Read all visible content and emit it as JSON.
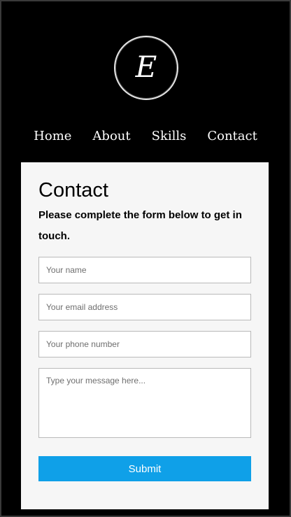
{
  "logo": {
    "letter": "E"
  },
  "nav": {
    "items": [
      {
        "label": "Home"
      },
      {
        "label": "About"
      },
      {
        "label": "Skills"
      },
      {
        "label": "Contact"
      }
    ]
  },
  "contact": {
    "title": "Contact",
    "subtitle": "Please complete the form below to get in touch.",
    "fields": {
      "name_placeholder": "Your name",
      "email_placeholder": "Your email address",
      "phone_placeholder": "Your phone number",
      "message_placeholder": "Type your message here..."
    },
    "submit_label": "Submit"
  },
  "colors": {
    "background": "#000000",
    "card": "#f6f6f6",
    "accent": "#0fa0e8"
  }
}
